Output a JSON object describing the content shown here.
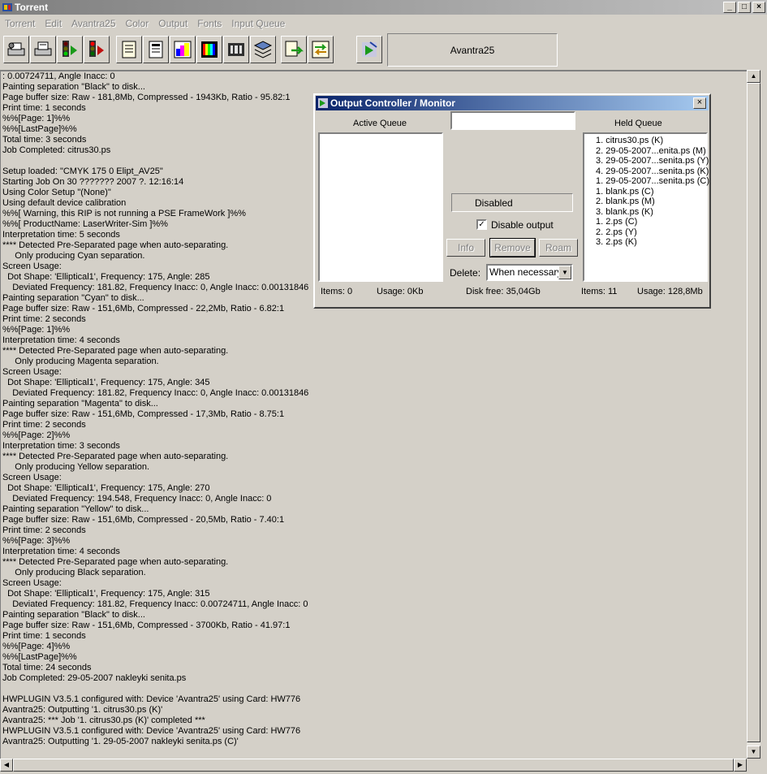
{
  "window": {
    "title": "Torrent",
    "min_glyph": "_",
    "max_glyph": "□",
    "close_glyph": "×"
  },
  "menu": [
    "Torrent",
    "Edit",
    "Avantra25",
    "Color",
    "Output",
    "Fonts",
    "Input Queue"
  ],
  "toolbar": {
    "device_name": "Avantra25",
    "buttons": [
      "printer-setup-icon",
      "printer-open-icon",
      "traffic-light-go-icon",
      "traffic-light-stop-icon",
      "document-icon",
      "document-list-icon",
      "color-palette-icon",
      "color-bars-icon",
      "film-icon",
      "stack-icon",
      "queue-forward-icon",
      "queue-arrow-icon",
      "output-controller-icon"
    ]
  },
  "log": [
    ": 0.00724711, Angle Inacc: 0",
    "Painting separation \"Black\" to disk...",
    "Page buffer size: Raw - 181,8Mb, Compressed - 1943Kb, Ratio - 95.82:1",
    "Print time: 1 seconds",
    "%%[Page: 1]%%",
    "%%[LastPage]%%",
    "Total time: 3 seconds",
    "Job Completed: citrus30.ps",
    "",
    "Setup loaded: \"CMYK 175 0 Elipt_AV25\"",
    "Starting Job On 30 ??????? 2007 ?. 12:16:14",
    "Using Color Setup \"(None)\"",
    "Using default device calibration",
    "%%[ Warning, this RIP is not running a PSE FrameWork ]%%",
    "%%[ ProductName: LaserWriter-Sim ]%%",
    "Interpretation time: 5 seconds",
    "**** Detected Pre-Separated page when auto-separating.",
    "     Only producing Cyan separation.",
    "Screen Usage:",
    "  Dot Shape: 'Elliptical1', Frequency: 175, Angle: 285",
    "    Deviated Frequency: 181.82, Frequency Inacc: 0, Angle Inacc: 0.00131846",
    "Painting separation \"Cyan\" to disk...",
    "Page buffer size: Raw - 151,6Mb, Compressed - 22,2Mb, Ratio - 6.82:1",
    "Print time: 2 seconds",
    "%%[Page: 1]%%",
    "Interpretation time: 4 seconds",
    "**** Detected Pre-Separated page when auto-separating.",
    "     Only producing Magenta separation.",
    "Screen Usage:",
    "  Dot Shape: 'Elliptical1', Frequency: 175, Angle: 345",
    "    Deviated Frequency: 181.82, Frequency Inacc: 0, Angle Inacc: 0.00131846",
    "Painting separation \"Magenta\" to disk...",
    "Page buffer size: Raw - 151,6Mb, Compressed - 17,3Mb, Ratio - 8.75:1",
    "Print time: 2 seconds",
    "%%[Page: 2]%%",
    "Interpretation time: 3 seconds",
    "**** Detected Pre-Separated page when auto-separating.",
    "     Only producing Yellow separation.",
    "Screen Usage:",
    "  Dot Shape: 'Elliptical1', Frequency: 175, Angle: 270",
    "    Deviated Frequency: 194.548, Frequency Inacc: 0, Angle Inacc: 0",
    "Painting separation \"Yellow\" to disk...",
    "Page buffer size: Raw - 151,6Mb, Compressed - 20,5Mb, Ratio - 7.40:1",
    "Print time: 2 seconds",
    "%%[Page: 3]%%",
    "Interpretation time: 4 seconds",
    "**** Detected Pre-Separated page when auto-separating.",
    "     Only producing Black separation.",
    "Screen Usage:",
    "  Dot Shape: 'Elliptical1', Frequency: 175, Angle: 315",
    "    Deviated Frequency: 181.82, Frequency Inacc: 0.00724711, Angle Inacc: 0",
    "Painting separation \"Black\" to disk...",
    "Page buffer size: Raw - 151,6Mb, Compressed - 3700Kb, Ratio - 41.97:1",
    "Print time: 1 seconds",
    "%%[Page: 4]%%",
    "%%[LastPage]%%",
    "Total time: 24 seconds",
    "Job Completed: 29-05-2007 nakleyki senita.ps",
    "",
    "HWPLUGIN V3.5.1 configured with: Device 'Avantra25' using Card: HW776",
    "Avantra25: Outputting '1. citrus30.ps (K)'",
    "Avantra25: *** Job '1. citrus30.ps (K)' completed ***",
    "HWPLUGIN V3.5.1 configured with: Device 'Avantra25' using Card: HW776",
    "Avantra25: Outputting '1. 29-05-2007 nakleyki senita.ps (C)'"
  ],
  "dialog": {
    "title": "Output Controller / Monitor",
    "close_glyph": "×",
    "active_queue_label": "Active Queue",
    "held_queue_label": "Held Queue",
    "search_value": "",
    "status": "Disabled",
    "disable_output_label": "Disable output",
    "disable_output_checked": true,
    "check_glyph": "✓",
    "info_label": "Info",
    "remove_label": "Remove",
    "roam_label": "Roam",
    "delete_label": "Delete:",
    "delete_value": "When necessary",
    "active_items": "Items:  0",
    "active_usage": "Usage: 0Kb",
    "disk_free": "Disk free:  35,04Gb",
    "held_items": "Items:  11",
    "held_usage": "Usage: 128,8Mb",
    "held_queue": [
      "1. citrus30.ps (K)",
      "2. 29-05-2007...enita.ps (M)",
      "3. 29-05-2007...senita.ps (Y)",
      "4. 29-05-2007...senita.ps (K)",
      "1. 29-05-2007...senita.ps (C)",
      "1. blank.ps (C)",
      "2. blank.ps (M)",
      "3. blank.ps (K)",
      "1. 2.ps (C)",
      "2. 2.ps (Y)",
      "3. 2.ps (K)"
    ]
  }
}
